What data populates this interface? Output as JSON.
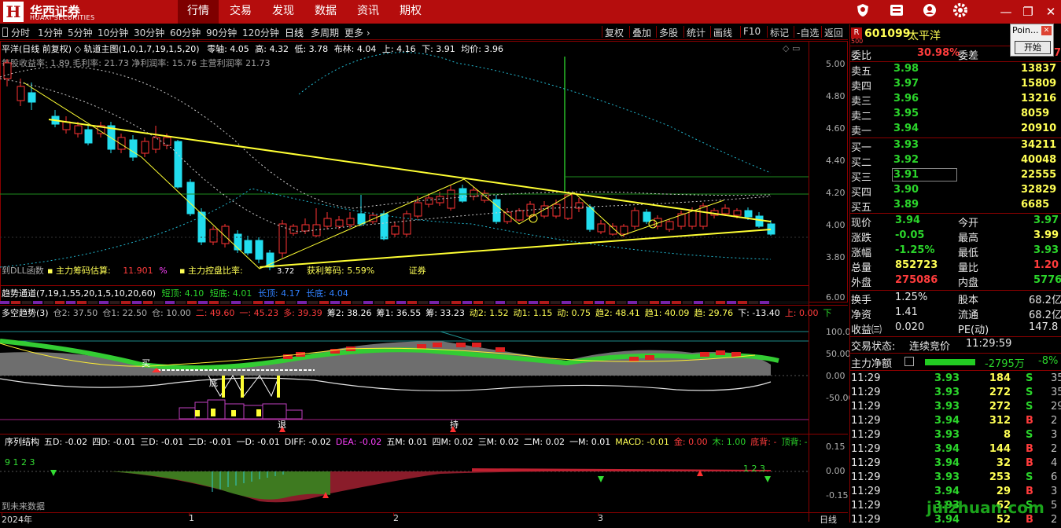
{
  "brand": {
    "mark": "H",
    "cn": "华西证券",
    "en": "HUAXI SECURITIES"
  },
  "menu": [
    "行情",
    "交易",
    "发现",
    "数据",
    "资讯",
    "期权"
  ],
  "toolbar_left": [
    "分时",
    "1分钟",
    "5分钟",
    "10分钟",
    "30分钟",
    "60分钟",
    "90分钟",
    "120分钟",
    "日线",
    "多周期",
    "更多 ›"
  ],
  "toolbar_right": [
    "复权",
    "叠加",
    "多股",
    "统计",
    "画线",
    "F10",
    "标记",
    "-自选",
    "返回"
  ],
  "main_chart": {
    "header": "平洋(日线 前复权) ◇ 轨道主图(1,0,1,7,19,1,5,20)",
    "zero_axis": "零轴: 4.05",
    "high": "高: 4.32",
    "low": "低: 3.78",
    "boll": "布林: 4.04",
    "up": "上: 4.16",
    "down": "下: 3.91",
    "avg": "均价: 3.96",
    "subline": "每股收益率: 1.89 毛利率: 21.73 净利润率: 15.76 主营利润率 21.73",
    "legend1_label": "主力筹码估算:",
    "legend1_value": "11.901",
    "legend1_unit": "%",
    "legend2_label": "主力控盘比率:",
    "legend3": "获利筹码: 5.59%",
    "legend4": "证券",
    "bottom_left": "到DLL函数",
    "low_label": "3.72",
    "y_ticks": [
      "5.00",
      "4.80",
      "4.60",
      "4.40",
      "4.20",
      "4.00",
      "3.80"
    ]
  },
  "channel_panel": {
    "title": "趋势通道(7,19,1,55,20,1,5,10,20,60)",
    "short_top": "短顶: 4.10",
    "short_bottom": "短底: 4.01",
    "long_top": "长顶: 4.17",
    "long_bottom": "长底: 4.04",
    "y_tick": "6.00"
  },
  "trend_panel": {
    "header": [
      {
        "t": "多空趋势(3)",
        "c": "wht"
      },
      {
        "t": "仓2: 37.50",
        "c": "gray"
      },
      {
        "t": "仓1: 22.50",
        "c": "gray"
      },
      {
        "t": "仓: 10.00",
        "c": "gray"
      },
      {
        "t": "二: 49.60",
        "c": "red"
      },
      {
        "t": "一: 45.23",
        "c": "red"
      },
      {
        "t": "多: 39.39",
        "c": "red"
      },
      {
        "t": "筹2: 38.26",
        "c": "wht"
      },
      {
        "t": "筹1: 36.55",
        "c": "wht"
      },
      {
        "t": "筹: 33.23",
        "c": "wht"
      },
      {
        "t": "动2: 1.52",
        "c": "yel"
      },
      {
        "t": "动1: 1.15",
        "c": "yel"
      },
      {
        "t": "动: 0.75",
        "c": "yel"
      },
      {
        "t": "趋2: 48.41",
        "c": "yel"
      },
      {
        "t": "趋1: 40.09",
        "c": "yel"
      },
      {
        "t": "趋: 29.76",
        "c": "yel"
      },
      {
        "t": "下: -13.40",
        "c": "wht"
      },
      {
        "t": "上: 0.00",
        "c": "red"
      },
      {
        "t": "下",
        "c": "grn"
      }
    ],
    "y_ticks": [
      "100.0",
      "50.00",
      "0.00",
      "-50.00"
    ],
    "buy_mark": "买",
    "bottom_mark": "底",
    "retreat_mark": "退",
    "hold_mark": "持"
  },
  "macd_panel": {
    "header": [
      {
        "t": "序列结构",
        "c": "wht"
      },
      {
        "t": "五D: -0.02",
        "c": "wht"
      },
      {
        "t": "四D: -0.01",
        "c": "wht"
      },
      {
        "t": "三D: -0.01",
        "c": "wht"
      },
      {
        "t": "二D: -0.01",
        "c": "wht"
      },
      {
        "t": "一D: -0.01",
        "c": "wht"
      },
      {
        "t": "DIFF: -0.02",
        "c": "wht"
      },
      {
        "t": "DEA: -0.02",
        "c": "mag"
      },
      {
        "t": "五M: 0.01",
        "c": "wht"
      },
      {
        "t": "四M: 0.02",
        "c": "wht"
      },
      {
        "t": "三M: 0.02",
        "c": "wht"
      },
      {
        "t": "二M: 0.02",
        "c": "wht"
      },
      {
        "t": "一M: 0.01",
        "c": "wht"
      },
      {
        "t": "MACD: -0.01",
        "c": "yel"
      },
      {
        "t": "金: 0.00",
        "c": "red"
      },
      {
        "t": "木: 1.00",
        "c": "grn"
      },
      {
        "t": "底背: -",
        "c": "red"
      },
      {
        "t": "顶背: -",
        "c": "grn"
      }
    ],
    "y_ticks": [
      "0.15",
      "0.00",
      "-0.15"
    ],
    "footer_note": "到未来数据",
    "seq_left": "9 1 2 3",
    "seq_right": "1 2 3"
  },
  "xaxis": {
    "labels": [
      "2024年",
      "1",
      "2",
      "3"
    ],
    "period": "日线"
  },
  "quote": {
    "code": "601099",
    "name": "太平洋",
    "r_badge": "R",
    "sub_badge": "500",
    "weibi_label": "委比",
    "weibi_value": "30.98%",
    "weicha_label": "委差",
    "weicha_value": "7",
    "asks": [
      {
        "label": "卖五",
        "price": "3.98",
        "vol": "13837"
      },
      {
        "label": "卖四",
        "price": "3.97",
        "vol": "15809"
      },
      {
        "label": "卖三",
        "price": "3.96",
        "vol": "13216"
      },
      {
        "label": "卖二",
        "price": "3.95",
        "vol": "8059"
      },
      {
        "label": "卖一",
        "price": "3.94",
        "vol": "20910"
      }
    ],
    "bids": [
      {
        "label": "买一",
        "price": "3.93",
        "vol": "34211"
      },
      {
        "label": "买二",
        "price": "3.92",
        "vol": "40048"
      },
      {
        "label": "买三",
        "price": "3.91",
        "vol": "22555"
      },
      {
        "label": "买四",
        "price": "3.90",
        "vol": "32829"
      },
      {
        "label": "买五",
        "price": "3.89",
        "vol": "6685"
      }
    ],
    "stats": [
      {
        "l1": "现价",
        "v1": "3.94",
        "c1": "grn",
        "l2": "今开",
        "v2": "3.97",
        "c2": "grn"
      },
      {
        "l1": "涨跌",
        "v1": "-0.05",
        "c1": "grn",
        "l2": "最高",
        "v2": "3.99",
        "c2": "yel"
      },
      {
        "l1": "涨幅",
        "v1": "-1.25%",
        "c1": "grn",
        "l2": "最低",
        "v2": "3.93",
        "c2": "grn"
      },
      {
        "l1": "总量",
        "v1": "852723",
        "c1": "yel",
        "l2": "量比",
        "v2": "1.20",
        "c2": "red"
      },
      {
        "l1": "外盘",
        "v1": "275086",
        "c1": "red",
        "l2": "内盘",
        "v2": "577637",
        "c2": "grn"
      }
    ],
    "stats2": [
      {
        "l1": "换手",
        "v1": "1.25%",
        "l2": "股本",
        "v2": "68.2亿"
      },
      {
        "l1": "净资",
        "v1": "1.41",
        "l2": "流通",
        "v2": "68.2亿"
      },
      {
        "l1": "收益㈢",
        "v1": "0.020",
        "l2": "PE(动)",
        "v2": "147.8"
      }
    ],
    "trade_status_label": "交易状态:",
    "trade_status": "连续竞价",
    "trade_time": "11:29:59",
    "net_label": "主力净额",
    "net_value": "-2795万",
    "net_pct": "-8%",
    "ticks": [
      {
        "t": "11:29",
        "p": "3.93",
        "v": "184",
        "s": "S",
        "n": "35"
      },
      {
        "t": "11:29",
        "p": "3.93",
        "v": "272",
        "s": "S",
        "n": "35"
      },
      {
        "t": "11:29",
        "p": "3.93",
        "v": "272",
        "s": "S",
        "n": "29"
      },
      {
        "t": "11:29",
        "p": "3.94",
        "v": "312",
        "s": "B",
        "n": "2"
      },
      {
        "t": "11:29",
        "p": "3.93",
        "v": "8",
        "s": "S",
        "n": "3"
      },
      {
        "t": "11:29",
        "p": "3.94",
        "v": "144",
        "s": "B",
        "n": "2"
      },
      {
        "t": "11:29",
        "p": "3.94",
        "v": "32",
        "s": "B",
        "n": "4"
      },
      {
        "t": "11:29",
        "p": "3.93",
        "v": "253",
        "s": "S",
        "n": "6"
      },
      {
        "t": "11:29",
        "p": "3.94",
        "v": "29",
        "s": "B",
        "n": "3"
      },
      {
        "t": "11:29",
        "p": "3.93",
        "v": "62",
        "s": "S",
        "n": "5"
      },
      {
        "t": "11:29",
        "p": "3.94",
        "v": "52",
        "s": "B",
        "n": "2"
      }
    ],
    "popup_title": "Poin...",
    "popup_button": "开始",
    "watermark": "juizhuan.com"
  }
}
